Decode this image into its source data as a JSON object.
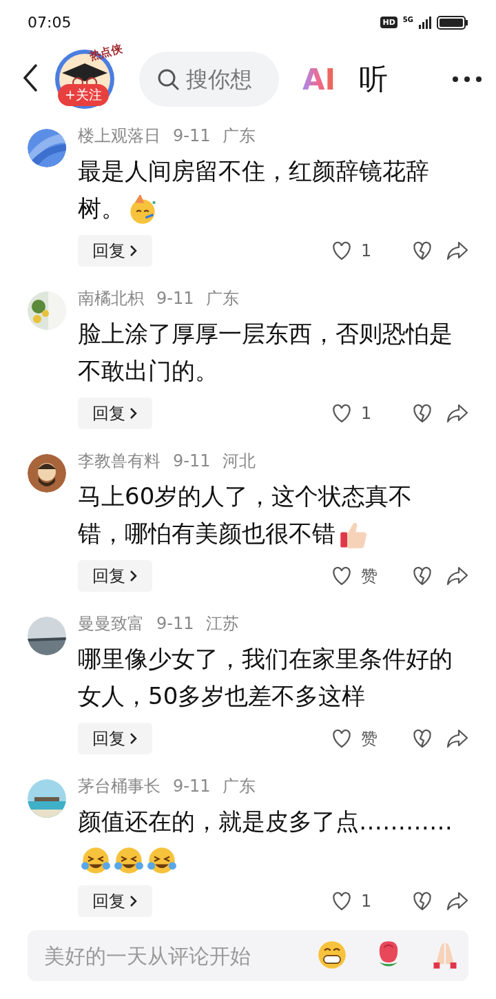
{
  "status_bar": {
    "time": "07:05",
    "hd_label": "HD",
    "network": "5G"
  },
  "header": {
    "channel_badge": "热点侠",
    "follow_label": "+关注",
    "search": {
      "placeholder": "搜你想"
    },
    "ai_label": "AI",
    "listen_label": "听"
  },
  "comments": [
    {
      "user": "楼上观落日",
      "date": "9-11",
      "region": "广东",
      "text": "最是人间房留不住，红颜辞镜花辞树。",
      "emojis": [
        {
          "kind": "party"
        }
      ],
      "reply_label": "回复",
      "likes": "1"
    },
    {
      "user": "南橘北枳",
      "date": "9-11",
      "region": "广东",
      "text": "脸上涂了厚厚一层东西，否则恐怕是不敢出门的。",
      "reply_label": "回复",
      "likes": "1"
    },
    {
      "user": "李教兽有料",
      "date": "9-11",
      "region": "河北",
      "text": "马上60岁的人了，这个状态真不错，哪怕有美颜也很不错",
      "emojis": [
        {
          "kind": "thumbs"
        }
      ],
      "reply_label": "回复",
      "likes": "赞"
    },
    {
      "user": "曼曼致富",
      "date": "9-11",
      "region": "江苏",
      "text": "哪里像少女了，我们在家里条件好的女人，50多岁也差不多这样",
      "reply_label": "回复",
      "likes": "赞"
    },
    {
      "user": "茅台桶事长",
      "date": "9-11",
      "region": "广东",
      "text": "颜值还在的，就是皮多了点…………",
      "emojis": [
        {
          "kind": "laugh"
        },
        {
          "kind": "laugh"
        },
        {
          "kind": "laugh"
        }
      ],
      "reply_label": "回复",
      "likes": "1"
    }
  ],
  "comment_bar": {
    "placeholder": "美好的一天从评论开始",
    "quick_emojis": [
      {
        "kind": "grin"
      },
      {
        "kind": "rose"
      },
      {
        "kind": "pray"
      }
    ]
  }
}
